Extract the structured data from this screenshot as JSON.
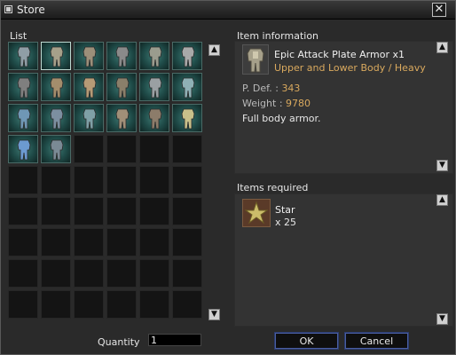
{
  "window": {
    "title": "Store"
  },
  "list": {
    "label": "List",
    "columns": 6,
    "rows": 9,
    "items": [
      {
        "name": "helmet-1",
        "color": "#8f9ea6"
      },
      {
        "name": "plate-armor-1",
        "color": "#a6a08a"
      },
      {
        "name": "gauntlet-1",
        "color": "#9c8f7a"
      },
      {
        "name": "greaves-1",
        "color": "#8a8a8a"
      },
      {
        "name": "armor-set-1",
        "color": "#9a9c8e"
      },
      {
        "name": "gauntlet-2",
        "color": "#a9a9a9"
      },
      {
        "name": "greaves-2",
        "color": "#7f7f7f"
      },
      {
        "name": "plate-armor-2",
        "color": "#a38d6c"
      },
      {
        "name": "gauntlet-3",
        "color": "#b59b76"
      },
      {
        "name": "greaves-3",
        "color": "#8a7f6a"
      },
      {
        "name": "helmet-2",
        "color": "#9aa0a3"
      },
      {
        "name": "robe-1",
        "color": "#8fb0b5"
      },
      {
        "name": "gauntlet-4",
        "color": "#6f97b5"
      },
      {
        "name": "boots-1",
        "color": "#7c8fa0"
      },
      {
        "name": "armor-2",
        "color": "#7fa0a6"
      },
      {
        "name": "gauntlet-5",
        "color": "#a08f78"
      },
      {
        "name": "boots-2",
        "color": "#8c7c6a"
      },
      {
        "name": "armor-3",
        "color": "#c9c08a"
      },
      {
        "name": "glove-blue",
        "color": "#6c9ad0"
      },
      {
        "name": "boots-3",
        "color": "#7a8a95"
      }
    ],
    "selected_index": 1,
    "quantity_label": "Quantity",
    "quantity_value": "1"
  },
  "item_info": {
    "header": "Item information",
    "name": "Epic Attack Plate Armor x1",
    "category": "Upper and Lower Body / Heavy",
    "pdef_label": "P. Def. :",
    "pdef_value": "343",
    "weight_label": "Weight :",
    "weight_value": "9780",
    "description": "Full body armor."
  },
  "required": {
    "header": "Items required",
    "item_name": "Star",
    "item_count": "x 25"
  },
  "buttons": {
    "ok": "OK",
    "cancel": "Cancel"
  },
  "colors": {
    "accent_gold": "#d9a95e",
    "cell_bg": "#141414",
    "slot_teal": "#3e7a74"
  }
}
